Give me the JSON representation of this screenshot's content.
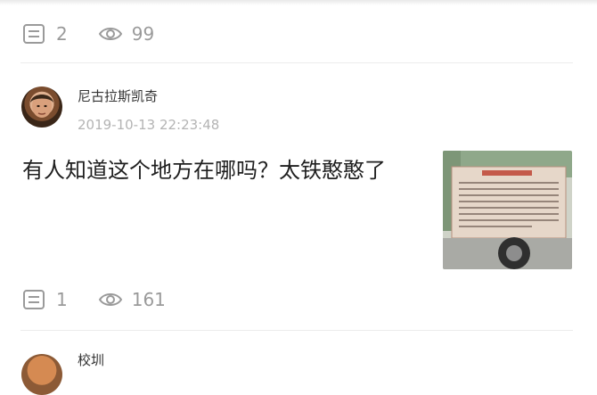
{
  "previous_post": {
    "comment_count": "2",
    "view_count": "99"
  },
  "post": {
    "username": "尼古拉斯凯奇",
    "timestamp": "2019-10-13 22:23:48",
    "text": "有人知道这个地方在哪吗？太铁憨憨了",
    "comment_count": "1",
    "view_count": "161",
    "thumbnail_icon": "notice-board-photo"
  },
  "next_post": {
    "username": "校圳"
  },
  "icons": {
    "comment": "comment-icon",
    "view": "eye-icon"
  },
  "colors": {
    "meta_gray": "#9a9a9a",
    "timestamp_gray": "#b4b4b4",
    "divider": "#ececec"
  }
}
